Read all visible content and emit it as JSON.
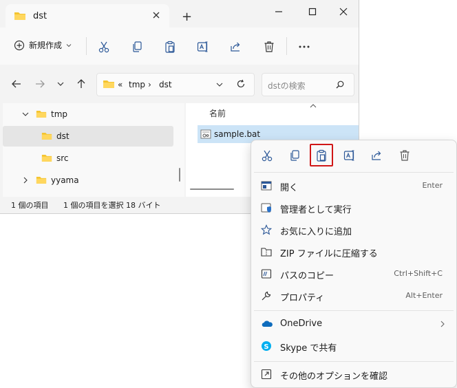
{
  "window": {
    "tab_title": "dst",
    "new_tab_glyph": "+"
  },
  "toolbar": {
    "new_label": "新規作成",
    "icons": [
      "cut-icon",
      "copy-icon",
      "paste-icon",
      "rename-icon",
      "share-icon",
      "delete-icon",
      "more-icon"
    ]
  },
  "address": {
    "overflow": "«",
    "crumbs": [
      "tmp",
      "dst"
    ],
    "separator": "›"
  },
  "search": {
    "placeholder": "dstの検索"
  },
  "tree": [
    {
      "label": "tmp",
      "expanded": true
    },
    {
      "label": "dst",
      "selected": true
    },
    {
      "label": "src"
    },
    {
      "label": "yyama",
      "expanded": false
    }
  ],
  "content": {
    "column_header": "名前",
    "files": [
      {
        "name": "sample.bat",
        "selected": true
      }
    ]
  },
  "status": {
    "item_count": "1 個の項目",
    "selection": "1 個の項目を選択 18 バイト"
  },
  "context_menu": {
    "top_icons": [
      "cut-icon",
      "copy-icon",
      "paste-icon",
      "rename-icon",
      "share-icon",
      "delete-icon"
    ],
    "highlight_color": "#d01616",
    "items": [
      {
        "label": "開く",
        "shortcut": "Enter",
        "icon": "open-icon"
      },
      {
        "label": "管理者として実行",
        "shortcut": "",
        "icon": "shield-icon"
      },
      {
        "label": "お気に入りに追加",
        "shortcut": "",
        "icon": "star-icon"
      },
      {
        "label": "ZIP ファイルに圧縮する",
        "shortcut": "",
        "icon": "zip-icon"
      },
      {
        "label": "パスのコピー",
        "shortcut": "Ctrl+Shift+C",
        "icon": "copy-path-icon"
      },
      {
        "label": "プロパティ",
        "shortcut": "Alt+Enter",
        "icon": "wrench-icon"
      },
      {
        "label": "OneDrive",
        "shortcut": "",
        "icon": "onedrive-icon",
        "submenu": true
      },
      {
        "label": "Skype で共有",
        "shortcut": "",
        "icon": "skype-icon"
      },
      {
        "label": "その他のオプションを確認",
        "shortcut": "",
        "icon": "more-options-icon"
      }
    ]
  }
}
